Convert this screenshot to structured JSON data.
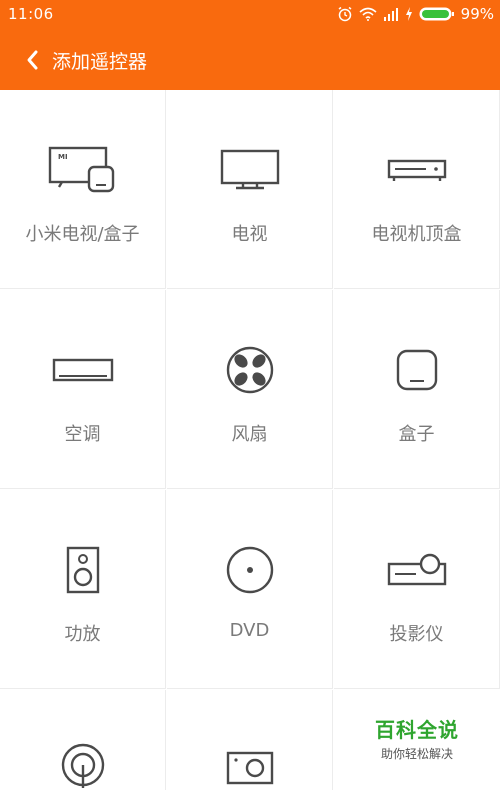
{
  "status_bar": {
    "time": "11:06",
    "battery": "99%",
    "icons": [
      "alarm-icon",
      "wifi-icon",
      "signal-icon",
      "charging-icon",
      "battery-icon"
    ]
  },
  "header": {
    "title": "添加遥控器",
    "back_icon": "chevron-left-icon",
    "color": "#f96a0e"
  },
  "devices": [
    {
      "label": "小米电视/盒子",
      "icon": "mi-tv-box-icon"
    },
    {
      "label": "电视",
      "icon": "tv-icon"
    },
    {
      "label": "电视机顶盒",
      "icon": "set-top-box-icon"
    },
    {
      "label": "空调",
      "icon": "air-conditioner-icon"
    },
    {
      "label": "风扇",
      "icon": "fan-icon"
    },
    {
      "label": "盒子",
      "icon": "box-icon"
    },
    {
      "label": "功放",
      "icon": "amplifier-icon"
    },
    {
      "label": "DVD",
      "icon": "dvd-icon"
    },
    {
      "label": "投影仪",
      "icon": "projector-icon"
    },
    {
      "label": "",
      "icon": "water-heater-icon"
    },
    {
      "label": "",
      "icon": "camera-icon"
    }
  ],
  "watermark": {
    "title": "百科全说",
    "subtitle": "助你轻松解决"
  }
}
